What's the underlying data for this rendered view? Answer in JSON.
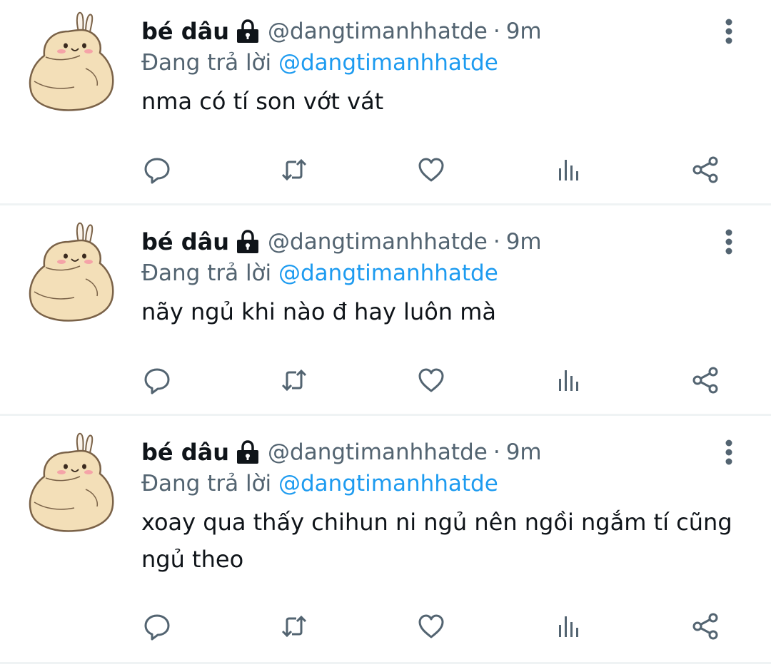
{
  "tweets": [
    {
      "name": "bé dâu",
      "handle": "@dangtimanhhatde",
      "separator": "·",
      "time": "9m",
      "reply_prefix": "Đang trả lời",
      "reply_to": "@dangtimanhhatde",
      "text": "nma có tí son vớt vát"
    },
    {
      "name": "bé dâu",
      "handle": "@dangtimanhhatde",
      "separator": "·",
      "time": "9m",
      "reply_prefix": "Đang trả lời",
      "reply_to": "@dangtimanhhatde",
      "text": "nãy ngủ khi nào đ hay luôn mà"
    },
    {
      "name": "bé dâu",
      "handle": "@dangtimanhhatde",
      "separator": "·",
      "time": "9m",
      "reply_prefix": "Đang trả lời",
      "reply_to": "@dangtimanhhatde",
      "text": "xoay qua thấy chihun ni ngủ nên ngồi ngắm tí cũng ngủ theo"
    }
  ],
  "icons": {
    "more": "more-vertical-icon",
    "reply": "reply-icon",
    "retweet": "retweet-icon",
    "like": "like-icon",
    "views": "views-icon",
    "share": "share-icon",
    "lock": "lock-icon"
  },
  "colors": {
    "text": "#0f1419",
    "secondary": "#536471",
    "mention": "#1d9bf0",
    "divider": "#eff3f4",
    "avatar_body": "#f3dfb8"
  }
}
